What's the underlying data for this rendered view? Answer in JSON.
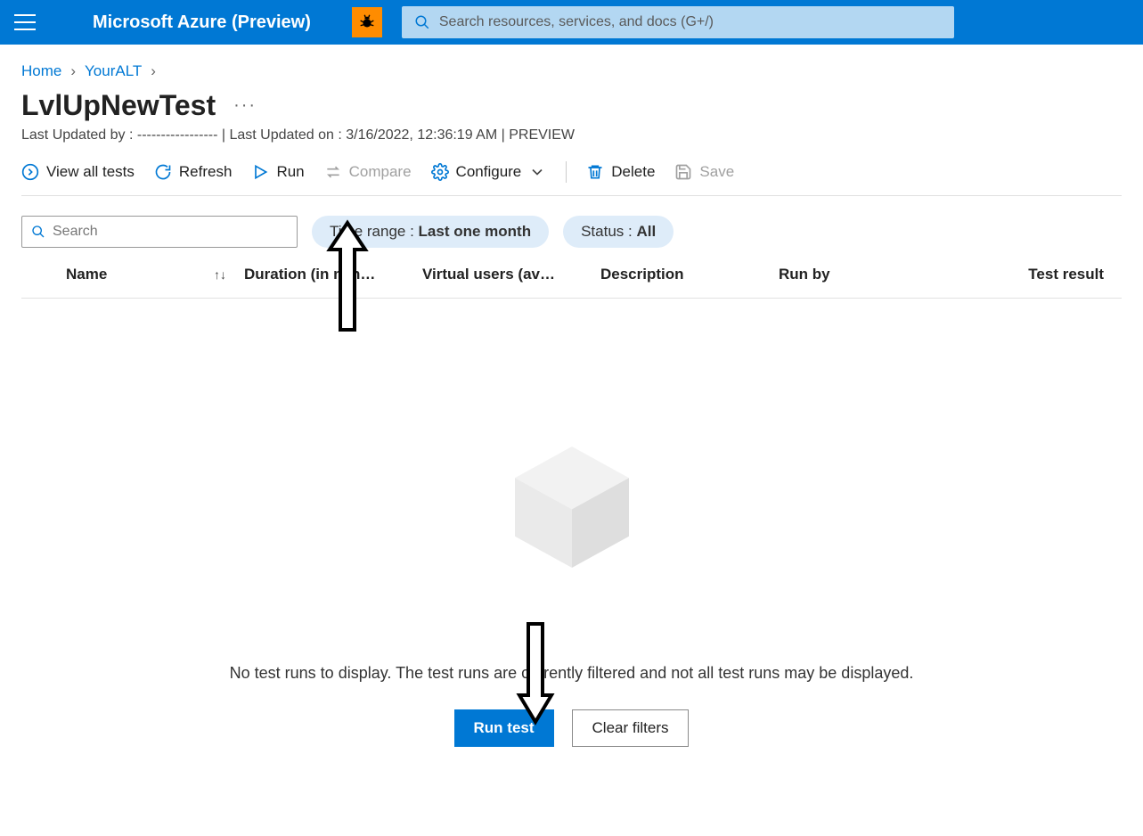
{
  "brand": "Microsoft Azure (Preview)",
  "search": {
    "placeholder": "Search resources, services, and docs (G+/)"
  },
  "breadcrumb": {
    "home": "Home",
    "resource": "YourALT"
  },
  "page": {
    "title": "LvlUpNewTest",
    "subtitle_prefix": "Last Updated by : ",
    "subtitle_by": "-----------------",
    "subtitle_sep": " | Last Updated on : ",
    "subtitle_date": "3/16/2022, 12:36:19 AM",
    "subtitle_suffix": " | PREVIEW"
  },
  "toolbar": {
    "view_all": "View all tests",
    "refresh": "Refresh",
    "run": "Run",
    "compare": "Compare",
    "configure": "Configure",
    "delete": "Delete",
    "save": "Save"
  },
  "filters": {
    "search_placeholder": "Search",
    "time_label": "Time range : ",
    "time_value": "Last one month",
    "status_label": "Status : ",
    "status_value": "All"
  },
  "columns": {
    "name": "Name",
    "duration": "Duration (in min…",
    "virtual": "Virtual users (av…",
    "description": "Description",
    "runby": "Run by",
    "result": "Test result"
  },
  "empty": {
    "message": "No test runs to display. The test runs are currently filtered and not all test runs may be displayed.",
    "run_test": "Run test",
    "clear_filters": "Clear filters"
  }
}
